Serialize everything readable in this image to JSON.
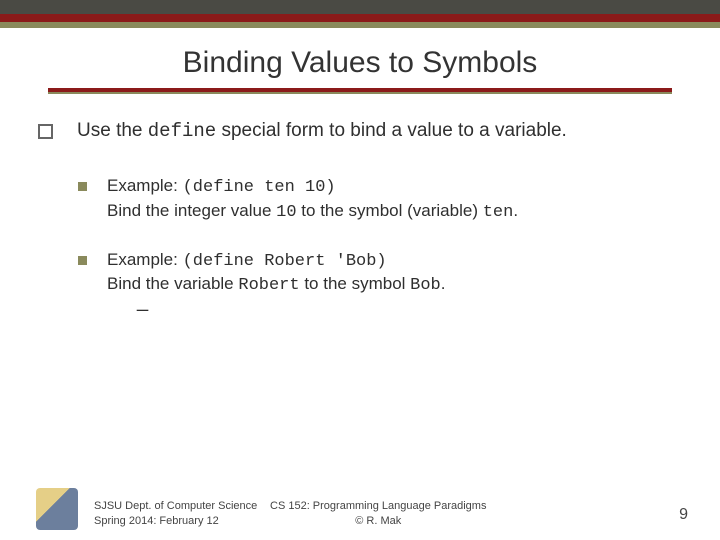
{
  "title": "Binding Values to Symbols",
  "main_bullet": {
    "pre": "Use the ",
    "code": "define",
    "post": " special form to bind a value to a variable."
  },
  "examples": [
    {
      "label": "Example: ",
      "code": "(define ten 10)",
      "desc_pre": "Bind the integer value ",
      "desc_code1": "10",
      "desc_mid": " to the symbol (variable) ",
      "desc_code2": "ten",
      "desc_post": "."
    },
    {
      "label": "Example: ",
      "code": "(define Robert 'Bob)",
      "desc_pre": "Bind the variable ",
      "desc_code1": "Robert",
      "desc_mid": " to the symbol ",
      "desc_code2": "Bob",
      "desc_post": "."
    }
  ],
  "footer": {
    "left_line1": "SJSU Dept. of Computer Science",
    "left_line2": "Spring 2014: February 12",
    "center_line1": "CS 152: Programming Language Paradigms",
    "center_line2": "© R. Mak",
    "page": "9"
  }
}
